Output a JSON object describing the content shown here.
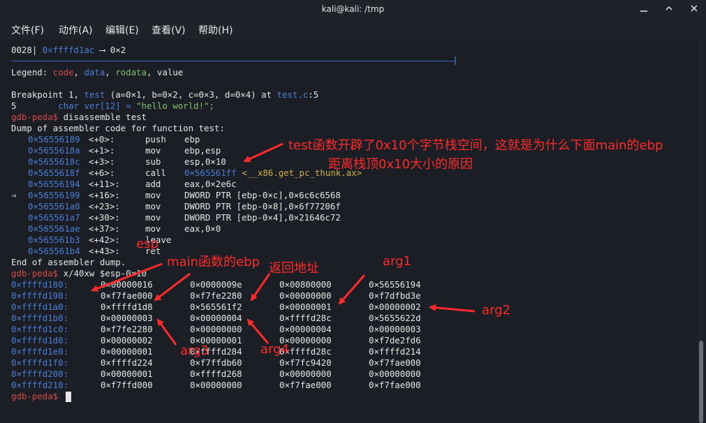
{
  "window": {
    "title": "kali@kali: /tmp"
  },
  "menu": [
    "文件(F)",
    "动作(A)",
    "编辑(E)",
    "查看(V)",
    "帮助(H)"
  ],
  "terminal": {
    "stack_line": {
      "offset": "0028|",
      "addr": "0×ffffd1ac",
      "arrow": "⟶",
      "val": "0×2"
    },
    "legend": {
      "prefix": "Legend: ",
      "code": "code",
      "data": "data",
      "rodata": "rodata",
      "value": "value",
      "sep": ", "
    },
    "breakpoint": {
      "pre": "Breakpoint 1, ",
      "func": "test",
      "args": " (a=0×1, b=0×2, c=0×3, d=0×4) at ",
      "file": "test.c",
      "line": ":5"
    },
    "source": {
      "num": "5",
      "code_pre": "        char ver[12] = ",
      "str": "\"hello world!\";"
    },
    "prompt": "gdb-peda$",
    "cmd1": " disassemble test",
    "dump_header": "Dump of assembler code for function test:",
    "asm": [
      {
        "marker": "",
        "addr": "0×56556189",
        "off": "<+0>:",
        "op": "push",
        "args": "ebp"
      },
      {
        "marker": "",
        "addr": "0×5655618a",
        "off": "<+1>:",
        "op": "mov",
        "args": "ebp,esp"
      },
      {
        "marker": "",
        "addr": "0×5655618c",
        "off": "<+3>:",
        "op": "sub",
        "args": "esp,0×10"
      },
      {
        "marker": "",
        "addr": "0×5655618f",
        "off": "<+6>:",
        "op": "call",
        "args": "0×565561ff <__x86.get_pc_thunk.ax>"
      },
      {
        "marker": "",
        "addr": "0×56556194",
        "off": "<+11>:",
        "op": "add",
        "args": "eax,0×2e6c"
      },
      {
        "marker": "⇒",
        "addr": "0×56556199",
        "off": "<+16>:",
        "op": "mov",
        "args": "DWORD PTR [ebp-0×c],0×6c6c6568"
      },
      {
        "marker": "",
        "addr": "0×565561a0",
        "off": "<+23>:",
        "op": "mov",
        "args": "DWORD PTR [ebp-0×8],0×6f77206f"
      },
      {
        "marker": "",
        "addr": "0×565561a7",
        "off": "<+30>:",
        "op": "mov",
        "args": "DWORD PTR [ebp-0×4],0×21646c72"
      },
      {
        "marker": "",
        "addr": "0×565561ae",
        "off": "<+37>:",
        "op": "mov",
        "args": "eax,0×0"
      },
      {
        "marker": "",
        "addr": "0×565561b3",
        "off": "<+42>:",
        "op": "leave",
        "args": ""
      },
      {
        "marker": "",
        "addr": "0×565561b4",
        "off": "<+43>:",
        "op": "ret",
        "args": ""
      }
    ],
    "dump_end": "End of assembler dump.",
    "cmd2": " x/40xw $esp-0×10",
    "memory": [
      {
        "addr": "0×ffffd180:",
        "v": [
          "0×00000016",
          "0×0000009e",
          "0×00800000",
          "0×56556194"
        ]
      },
      {
        "addr": "0×ffffd190:",
        "v": [
          "0×f7fae000",
          "0×f7fe2280",
          "0×00000000",
          "0×f7dfbd3e"
        ]
      },
      {
        "addr": "0×ffffd1a0:",
        "v": [
          "0×ffffd1d8",
          "0×565561f2",
          "0×00000001",
          "0×00000002"
        ]
      },
      {
        "addr": "0×ffffd1b0:",
        "v": [
          "0×00000003",
          "0×00000004",
          "0×ffffd28c",
          "0×5655622d"
        ]
      },
      {
        "addr": "0×ffffd1c0:",
        "v": [
          "0×f7fe2280",
          "0×00000000",
          "0×00000004",
          "0×00000003"
        ]
      },
      {
        "addr": "0×ffffd1d0:",
        "v": [
          "0×00000002",
          "0×00000001",
          "0×00000000",
          "0×f7de2fd6"
        ]
      },
      {
        "addr": "0×ffffd1e0:",
        "v": [
          "0×00000001",
          "0×ffffd284",
          "0×ffffd28c",
          "0×ffffd214"
        ]
      },
      {
        "addr": "0×ffffd1f0:",
        "v": [
          "0×ffffd224",
          "0×f7ffdb60",
          "0×f7fc9420",
          "0×f7fae000"
        ]
      },
      {
        "addr": "0×ffffd200:",
        "v": [
          "0×00000001",
          "0×ffffd268",
          "0×00000000",
          "0×00000000"
        ]
      },
      {
        "addr": "0×ffffd210:",
        "v": [
          "0×f7ffd000",
          "0×00000000",
          "0×f7fae000",
          "0×f7fae000"
        ]
      }
    ]
  },
  "annotations": {
    "note1": "test函数开辟了0x10个字节栈空间，这就是为什么下面main的ebp",
    "note2": "距离栈顶0x10大小的原因",
    "esp": "esp",
    "main_ebp": "main函数的ebp",
    "ret_addr": "返回地址",
    "arg1": "arg1",
    "arg2": "arg2",
    "arg3": "arg3",
    "arg4": "arg4"
  },
  "colors": {
    "accent_red": "#ff2b2b",
    "addr_blue": "#4a7fd8",
    "prompt_red": "#d24b4b",
    "string_green": "#7fc16d"
  }
}
